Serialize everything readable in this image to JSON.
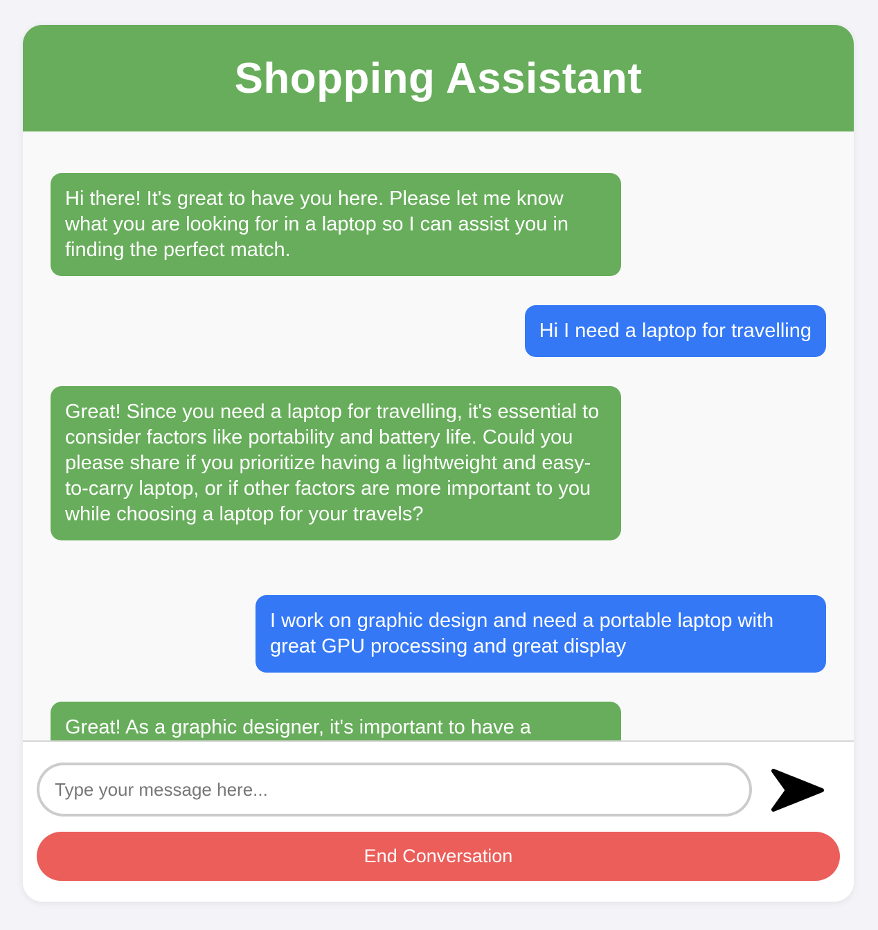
{
  "header": {
    "title": "Shopping Assistant"
  },
  "messages": [
    {
      "role": "assistant",
      "text": "Hi there! It's great to have you here. Please let me know what you are looking for in a laptop so I can assist you in finding the perfect match."
    },
    {
      "role": "user",
      "text": "Hi I need a laptop for travelling"
    },
    {
      "role": "assistant",
      "text": "Great! Since you need a laptop for travelling, it's essential to consider factors like portability and battery life. Could you please share if you prioritize having a lightweight and easy-to-carry laptop, or if other factors are more important to you while choosing a laptop for your travels?"
    },
    {
      "role": "user",
      "text": "I work on graphic design and need a portable laptop with great GPU processing and great display"
    },
    {
      "role": "assistant",
      "text": "Great! As a graphic designer, it's important to have a"
    }
  ],
  "composer": {
    "placeholder": "Type your message here...",
    "value": "",
    "send_icon": "send-arrow-icon"
  },
  "actions": {
    "end_label": "End Conversation"
  },
  "colors": {
    "assistant_bubble": "#67ad5b",
    "user_bubble": "#3478f6",
    "end_button": "#eb5e5a",
    "header": "#67ad5b"
  }
}
